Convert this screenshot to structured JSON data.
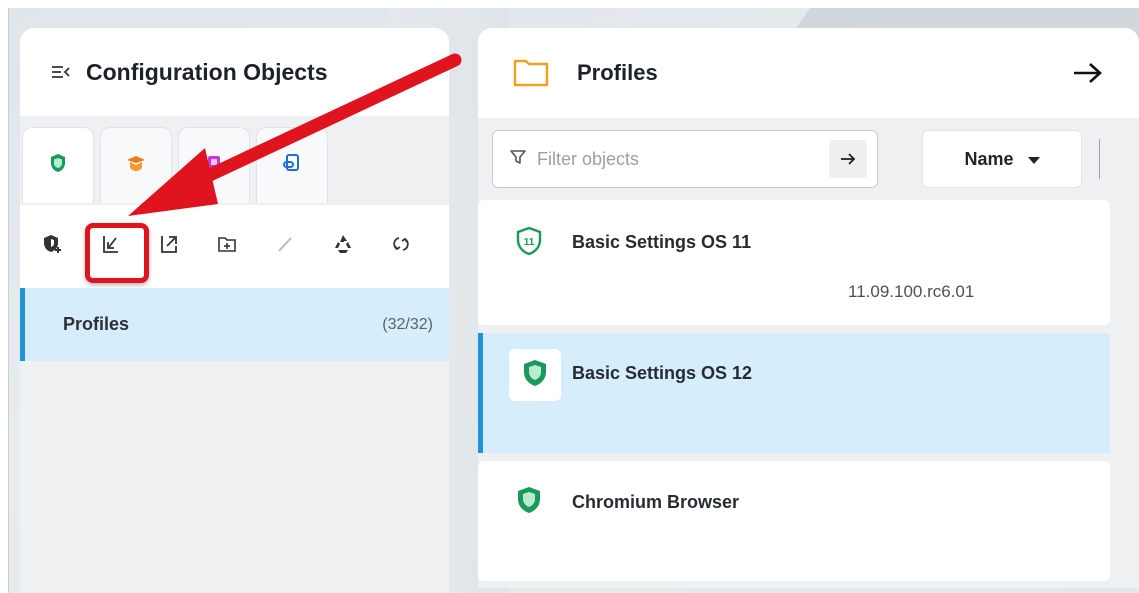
{
  "left_panel": {
    "title": "Configuration Objects",
    "tabs": [
      {
        "name": "profiles-tab",
        "icon": "shield-icon",
        "active": true
      },
      {
        "name": "certificates-tab",
        "icon": "graduate-shield-icon",
        "active": false
      },
      {
        "name": "devices-tab",
        "icon": "device-icon",
        "active": false
      },
      {
        "name": "links-tab",
        "icon": "link-document-icon",
        "active": false
      }
    ],
    "toolbar": [
      {
        "name": "add-profile-button",
        "icon": "shield-plus-icon"
      },
      {
        "name": "import-button",
        "icon": "import-icon",
        "highlighted": true
      },
      {
        "name": "export-button",
        "icon": "export-icon"
      },
      {
        "name": "new-folder-button",
        "icon": "folder-plus-icon"
      },
      {
        "name": "edit-button",
        "icon": "pencil-icon"
      },
      {
        "name": "recycle-button",
        "icon": "recycle-icon"
      },
      {
        "name": "refresh-button",
        "icon": "refresh-icon"
      }
    ],
    "tree": {
      "label": "Profiles",
      "count": "(32/32)"
    }
  },
  "right_panel": {
    "title": "Profiles",
    "filter": {
      "placeholder": "Filter objects",
      "value": ""
    },
    "sort": {
      "label": "Name"
    },
    "items": [
      {
        "title": "Basic Settings OS 11",
        "subtitle": "11.09.100.rc6.01",
        "selected": false,
        "badge": "11"
      },
      {
        "title": "Basic Settings OS 12",
        "subtitle": "",
        "selected": true,
        "badge": ""
      },
      {
        "title": "Chromium Browser",
        "subtitle": "",
        "selected": false,
        "badge": ""
      }
    ]
  },
  "colors": {
    "accent_blue": "#1f93d6",
    "selection_bg": "#d6eefb",
    "shield_green": "#1a9a5a",
    "annotation_red": "#e0141e",
    "folder_orange": "#f2a01c"
  }
}
